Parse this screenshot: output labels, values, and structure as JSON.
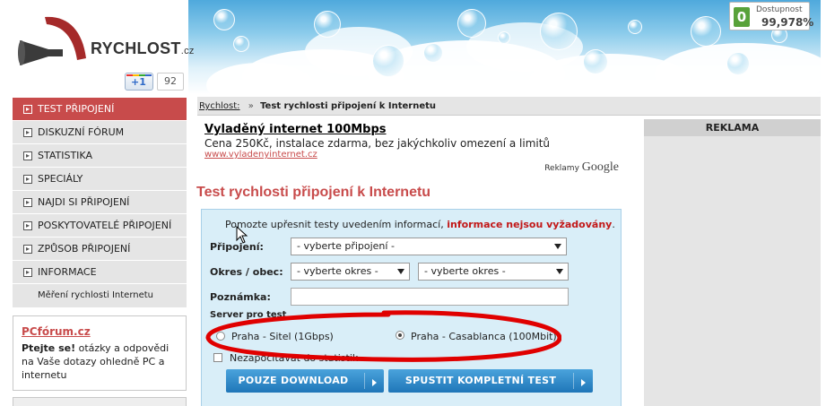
{
  "header": {
    "logo_text": "RYCHLOST",
    "logo_tld": ".cz",
    "gplus_label": "+1",
    "gplus_count": "92",
    "uptime_icon": "0",
    "uptime_label": "Dostupnost",
    "uptime_value": "99,978%"
  },
  "sidebar": {
    "items": [
      {
        "label": "TEST PŘIPOJENÍ",
        "active": true
      },
      {
        "label": "DISKUZNÍ FÓRUM"
      },
      {
        "label": "STATISTIKA"
      },
      {
        "label": "SPECIÁLY"
      },
      {
        "label": "NAJDI SI PŘIPOJENÍ"
      },
      {
        "label": "POSKYTOVATELÉ PŘIPOJENÍ"
      },
      {
        "label": "ZPŮSOB PŘIPOJENÍ"
      },
      {
        "label": "INFORMACE"
      }
    ],
    "sub_item": "Měření rychlosti Internetu",
    "active_color": "#c84b4b"
  },
  "pcforum": {
    "title": "PCfórum.cz",
    "bold_lead": "Ptejte se!",
    "text": " otázky a odpovědi na Vaše dotazy ohledně PC a internetu"
  },
  "breadcrumb": {
    "home": "Rychlost:",
    "separator": "»",
    "current": "Test rychlosti připojení k Internetu"
  },
  "ad": {
    "title": "Vyladěný internet 100Mbps",
    "text": "Cena 250Kč, instalace zdarma, bez jakýchkoliv omezení a limitů",
    "url": "www.vyladenyinternet.cz",
    "google_label": "Reklamy",
    "google_brand": "Google"
  },
  "right": {
    "reklama": "REKLAMA"
  },
  "main": {
    "title": "Test rychlosti připojení k Internetu",
    "intro_text": "Pomozte upřesnit testy uvedením informací, ",
    "intro_required": "informace nejsou vyžadovány",
    "intro_end": ".",
    "form": {
      "connection_label": "Připojení:",
      "connection_value": "- vyberte připojení -",
      "district_label": "Okres / obec:",
      "district_value": "- vyberte okres -",
      "district2_value": "- vyberte okres -",
      "note_label": "Poznámka:",
      "note_value": "",
      "server_label": "Server pro test",
      "server_options": [
        {
          "label": "Praha - Sitel (1Gbps)",
          "checked": false
        },
        {
          "label": "Praha - Casablanca (100Mbit)",
          "checked": true
        }
      ],
      "checkbox_label": "Nezapočítávat do statistik",
      "button_download": "POUZE DOWNLOAD",
      "button_full": "SPUSTIT KOMPLETNÍ TEST"
    }
  },
  "colors": {
    "accent_red": "#c84b4b",
    "button_blue": "#2a86c8",
    "form_bg": "#d9eef8",
    "annotation_red": "#e00000"
  }
}
